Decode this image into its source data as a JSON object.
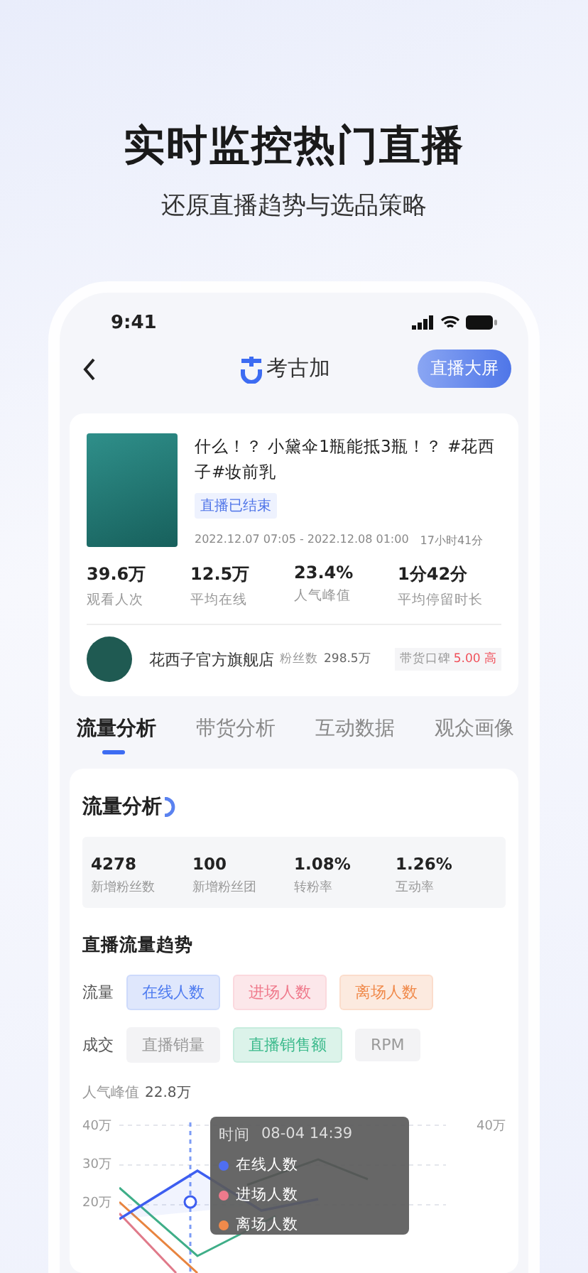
{
  "headline": "实时监控热门直播",
  "subheadline": "还原直播趋势与选品策略",
  "status_bar": {
    "time": "9:41"
  },
  "nav": {
    "logo_text": "考古加",
    "action": "直播大屏"
  },
  "live": {
    "title": "什么！？ 小黛伞1瓶能抵3瓶！？ #花西子#妆前乳",
    "status": "直播已结束",
    "time_range": "2022.12.07 07:05 - 2022.12.08 01:00",
    "duration": "17小时41分",
    "stats": [
      {
        "value": "39.6万",
        "label": "观看人次"
      },
      {
        "value": "12.5万",
        "label": "平均在线"
      },
      {
        "value": "23.4%",
        "label": "人气峰值"
      },
      {
        "value": "1分42分",
        "label": "平均停留时长"
      }
    ],
    "shop": {
      "name": "花西子官方旗舰店",
      "fans_label": "粉丝数",
      "fans": "298.5万",
      "rating_label": "带货口碑",
      "rating": "5.00 高"
    }
  },
  "tabs": [
    {
      "label": "流量分析",
      "selected": true
    },
    {
      "label": "带货分析",
      "selected": false
    },
    {
      "label": "互动数据",
      "selected": false
    },
    {
      "label": "观众画像",
      "selected": false
    }
  ],
  "analysis": {
    "title": "流量分析",
    "metrics": [
      {
        "value": "4278",
        "label": "新增粉丝数"
      },
      {
        "value": "100",
        "label": "新增粉丝团"
      },
      {
        "value": "1.08%",
        "label": "转粉率"
      },
      {
        "value": "1.26%",
        "label": "互动率"
      }
    ],
    "trend_title": "直播流量趋势",
    "filter_rows": [
      {
        "label": "流量",
        "chips": [
          {
            "label": "在线人数",
            "selected": true,
            "color": "#4f7cf0"
          },
          {
            "label": "进场人数",
            "selected": true,
            "color": "#ef7a8c"
          },
          {
            "label": "离场人数",
            "selected": true,
            "color": "#f08a4b"
          }
        ]
      },
      {
        "label": "成交",
        "chips": [
          {
            "label": "直播销量",
            "selected": false
          },
          {
            "label": "直播销售额",
            "selected": true,
            "color": "#3cba8c"
          },
          {
            "label": "RPM",
            "selected": false
          }
        ]
      }
    ],
    "peak_label": "人气峰值",
    "peak_value": "22.8万",
    "y_ticks_left": [
      "40万",
      "30万",
      "20万"
    ],
    "y_ticks_right": [
      "40万"
    ],
    "tooltip": {
      "time_label": "时间",
      "time": "08-04 14:39",
      "items": [
        {
          "label": "在线人数",
          "color": "#4f6ef0"
        },
        {
          "label": "进场人数",
          "color": "#ef7a8c"
        },
        {
          "label": "离场人数",
          "color": "#f08a4b"
        }
      ]
    }
  }
}
